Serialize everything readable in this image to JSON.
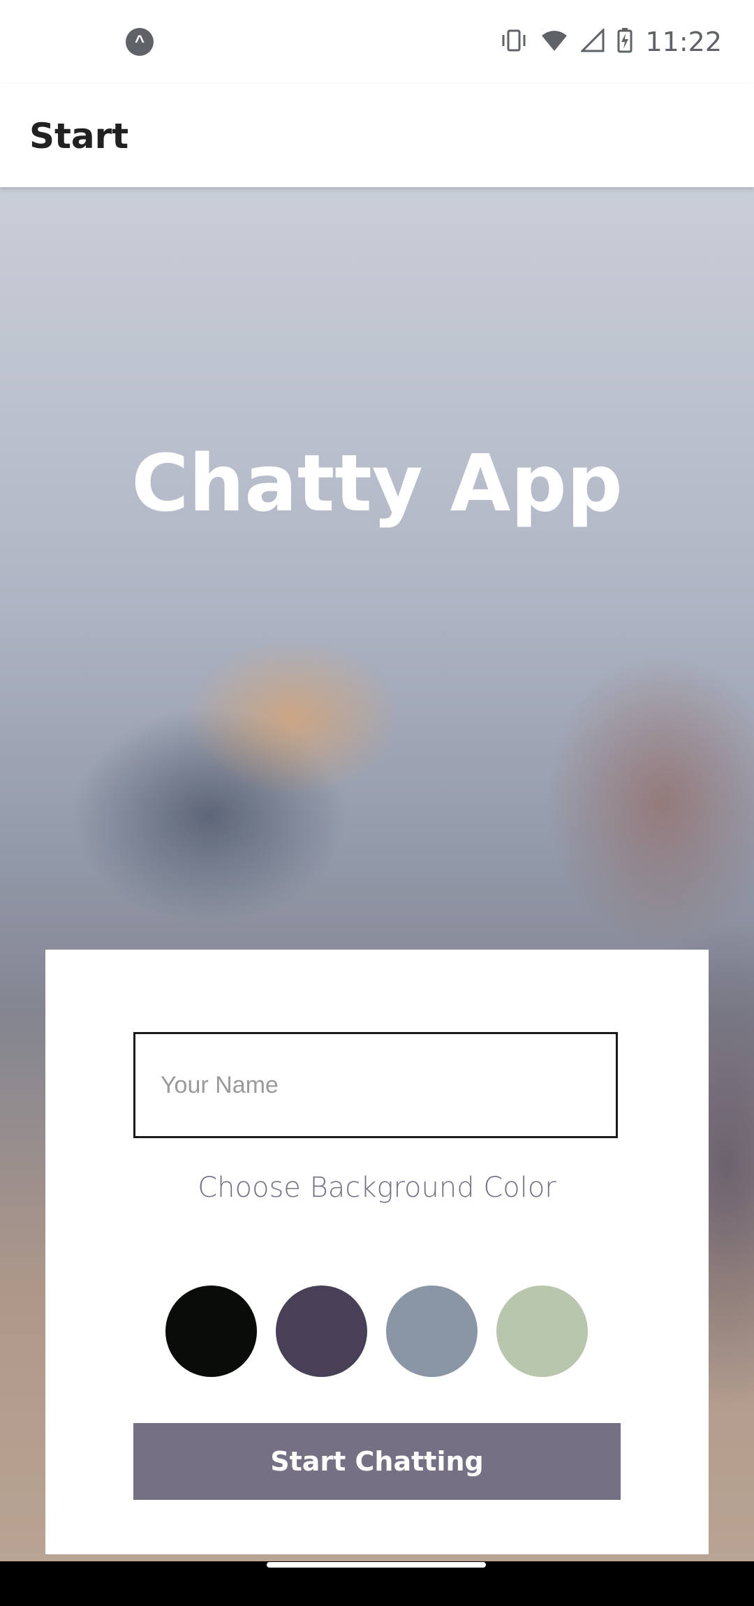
{
  "status_bar": {
    "time": "11:22",
    "app_icon": "expo-icon",
    "icons": [
      "vibrate-icon",
      "wifi-icon",
      "signal-icon",
      "battery-charging-icon"
    ]
  },
  "app_bar": {
    "title": "Start"
  },
  "hero": {
    "title": "Chatty App"
  },
  "form": {
    "name_placeholder": "Your Name",
    "name_value": "",
    "choose_label": "Choose Background Color",
    "colors": [
      {
        "name": "color-black",
        "hex": "#090C08"
      },
      {
        "name": "color-purple",
        "hex": "#474056"
      },
      {
        "name": "color-gray-blue",
        "hex": "#8A95A5"
      },
      {
        "name": "color-green",
        "hex": "#B9C6AE"
      }
    ],
    "button_label": "Start Chatting",
    "button_color": "#757083"
  },
  "expo_glyph": "^"
}
